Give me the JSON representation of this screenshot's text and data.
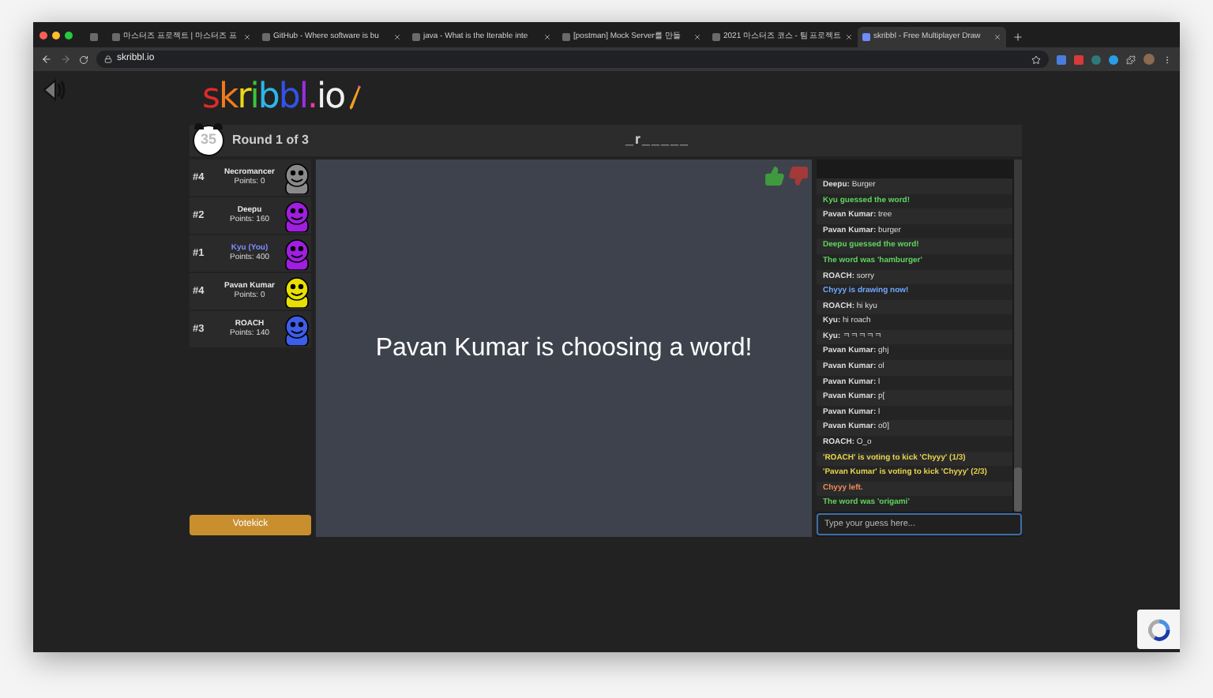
{
  "browser": {
    "tabs": [
      {
        "selected": false,
        "kind": "pinned"
      },
      {
        "title": "마스터즈 프로젝트 | 마스터즈 프",
        "selected": false,
        "kind": "page"
      },
      {
        "title": "GitHub - Where software is bu",
        "selected": false,
        "kind": "page"
      },
      {
        "title": "java - What is the Iterable inte",
        "selected": false,
        "kind": "page"
      },
      {
        "title": "[postman] Mock Server를 만들",
        "selected": false,
        "kind": "page"
      },
      {
        "title": "2021 마스터즈 코스 - 팀 프로젝트",
        "selected": false,
        "kind": "page"
      },
      {
        "title": "skribbl - Free Multiplayer Draw",
        "selected": true,
        "kind": "page"
      }
    ],
    "url": "skribbl.io"
  },
  "game": {
    "logo": "skribbl.io",
    "timer": "35",
    "round": "Round 1 of 3",
    "word_hint": "_r_____",
    "players": [
      {
        "rank": "#4",
        "name": "Necromancer",
        "points": "Points: 0",
        "you": false,
        "color": "#8a8a8a"
      },
      {
        "rank": "#2",
        "name": "Deepu",
        "points": "Points: 160",
        "you": false,
        "color": "#a01ee0"
      },
      {
        "rank": "#1",
        "name": "Kyu (You)",
        "points": "Points: 400",
        "you": true,
        "color": "#a01ee0"
      },
      {
        "rank": "#4",
        "name": "Pavan Kumar",
        "points": "Points: 0",
        "you": false,
        "color": "#e8e000"
      },
      {
        "rank": "#3",
        "name": "ROACH",
        "points": "Points: 140",
        "you": false,
        "color": "#3d5ee8"
      }
    ],
    "votekick": "Votekick",
    "canvas_message": "Pavan Kumar is choosing a word!",
    "chat": [
      {
        "kind": "chat",
        "name": "Deepu:",
        "text": "Burger"
      },
      {
        "kind": "guess",
        "text": "Kyu guessed the word!"
      },
      {
        "kind": "chat",
        "name": "Pavan Kumar:",
        "text": "tree"
      },
      {
        "kind": "chat",
        "name": "Pavan Kumar:",
        "text": "burger"
      },
      {
        "kind": "guess",
        "text": "Deepu guessed the word!"
      },
      {
        "kind": "guess",
        "text": "The word was 'hamburger'"
      },
      {
        "kind": "chat",
        "name": "ROACH:",
        "text": "sorry"
      },
      {
        "kind": "drawing",
        "text": "Chyyy is drawing now!"
      },
      {
        "kind": "chat",
        "name": "ROACH:",
        "text": "hi kyu"
      },
      {
        "kind": "chat",
        "name": "Kyu:",
        "text": "hi roach"
      },
      {
        "kind": "chat",
        "name": "Kyu:",
        "text": "ㅋㅋㅋㅋㅋ"
      },
      {
        "kind": "chat",
        "name": "Pavan Kumar:",
        "text": "ghj"
      },
      {
        "kind": "chat",
        "name": "Pavan Kumar:",
        "text": "ol"
      },
      {
        "kind": "chat",
        "name": "Pavan Kumar:",
        "text": "l"
      },
      {
        "kind": "chat",
        "name": "Pavan Kumar:",
        "text": "p["
      },
      {
        "kind": "chat",
        "name": "Pavan Kumar:",
        "text": "l"
      },
      {
        "kind": "chat",
        "name": "Pavan Kumar:",
        "text": "o0]"
      },
      {
        "kind": "chat",
        "name": "ROACH:",
        "text": "O_o"
      },
      {
        "kind": "vote",
        "text": "'ROACH' is voting to kick 'Chyyy' (1/3)"
      },
      {
        "kind": "vote",
        "text": "'Pavan Kumar' is voting to kick 'Chyyy' (2/3)"
      },
      {
        "kind": "left",
        "text": "Chyyy left."
      },
      {
        "kind": "guess",
        "text": "The word was 'origami'"
      }
    ],
    "chat_input": {
      "placeholder": "Type your guess here..."
    }
  }
}
